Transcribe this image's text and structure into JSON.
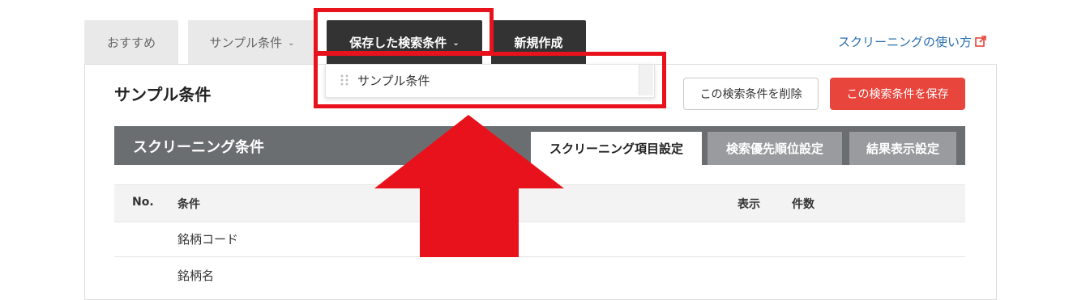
{
  "tabs": [
    {
      "label": "おすすめ"
    },
    {
      "label": "サンプル条件"
    },
    {
      "label": "保存した検索条件"
    },
    {
      "label": "新規作成"
    }
  ],
  "help_link": {
    "label": "スクリーニングの使い方",
    "icon": "external-link-icon"
  },
  "dropdown": {
    "items": [
      {
        "label": "サンプル条件"
      }
    ]
  },
  "page_title": "サンプル条件",
  "actions": {
    "delete_label": "この検索条件を削除",
    "save_label": "この検索条件を保存"
  },
  "section": {
    "title": "スクリーニング条件",
    "tabs": [
      {
        "label": "スクリーニング項目設定"
      },
      {
        "label": "検索優先順位設定"
      },
      {
        "label": "結果表示設定"
      }
    ]
  },
  "table": {
    "headers": {
      "no": "No.",
      "condition": "条件",
      "display": "表示",
      "count": "件数"
    },
    "rows": [
      {
        "condition": "銘柄コード"
      },
      {
        "condition": "銘柄名"
      }
    ]
  },
  "colors": {
    "accent_red": "#e8453c",
    "annotation_red": "#e8121c",
    "link_blue": "#2a6db0",
    "tab_dark": "#333333",
    "section_bar": "#6b6e71"
  }
}
